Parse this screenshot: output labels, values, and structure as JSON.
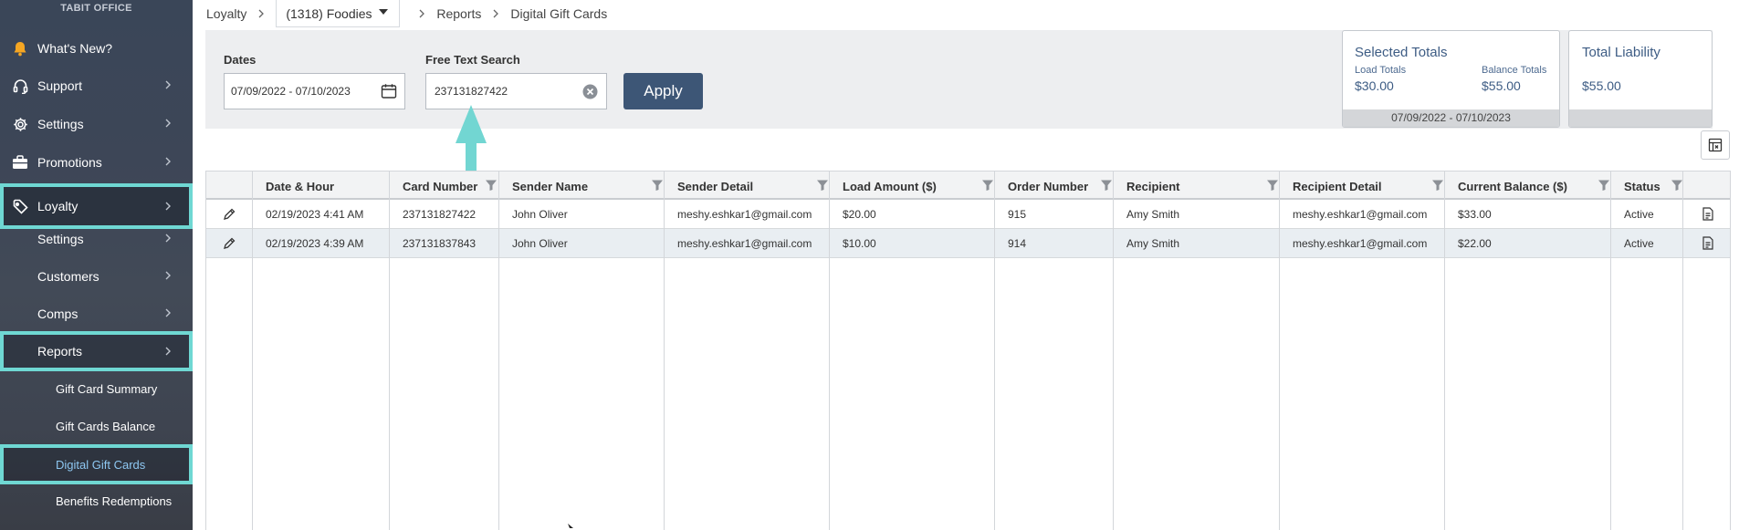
{
  "sidebar": {
    "brand": "TABIT OFFICE",
    "items": [
      {
        "label": "What's New?",
        "icon": "bell-icon"
      },
      {
        "label": "Support",
        "icon": "headset-icon"
      },
      {
        "label": "Settings",
        "icon": "gear-icon"
      },
      {
        "label": "Promotions",
        "icon": "briefcase-icon"
      },
      {
        "label": "Loyalty",
        "icon": "tag-icon"
      },
      {
        "label": "Settings"
      },
      {
        "label": "Customers"
      },
      {
        "label": "Comps"
      },
      {
        "label": "Reports"
      },
      {
        "label": "Gift Card Summary"
      },
      {
        "label": "Gift Cards Balance"
      },
      {
        "label": "Digital Gift Cards"
      },
      {
        "label": "Benefits Redemptions"
      }
    ]
  },
  "breadcrumb": {
    "root": "Loyalty",
    "venue": "(1318) Foodies",
    "section": "Reports",
    "page": "Digital Gift Cards"
  },
  "filters": {
    "dates_label": "Dates",
    "dates_value": "07/09/2022 - 07/10/2023",
    "search_label": "Free Text Search",
    "search_value": "237131827422",
    "apply_label": "Apply"
  },
  "selected_totals": {
    "title": "Selected Totals",
    "load_label": "Load Totals",
    "load_value": "$30.00",
    "balance_label": "Balance Totals",
    "balance_value": "$55.00",
    "range": "07/09/2022 - 07/10/2023"
  },
  "total_liability": {
    "title": "Total Liability",
    "value": "$55.00"
  },
  "table": {
    "columns": [
      "Date & Hour",
      "Card Number",
      "Sender Name",
      "Sender Detail",
      "Load Amount ($)",
      "Order Number",
      "Recipient",
      "Recipient Detail",
      "Current Balance ($)",
      "Status"
    ],
    "rows": [
      [
        "02/19/2023 4:41 AM",
        "237131827422",
        "John Oliver",
        "meshy.eshkar1@gmail.com",
        "$20.00",
        "915",
        "Amy Smith",
        "meshy.eshkar1@gmail.com",
        "$33.00",
        "Active"
      ],
      [
        "02/19/2023 4:39 AM",
        "237131837843",
        "John Oliver",
        "meshy.eshkar1@gmail.com",
        "$10.00",
        "914",
        "Amy Smith",
        "meshy.eshkar1@gmail.com",
        "$22.00",
        "Active"
      ]
    ]
  },
  "colors": {
    "sidebar_bg": "#3d4657",
    "highlight": "#6fd8d3",
    "apply_button": "#3d5676",
    "active_link": "#8ec8f2",
    "totals_text": "#3d5c84"
  }
}
